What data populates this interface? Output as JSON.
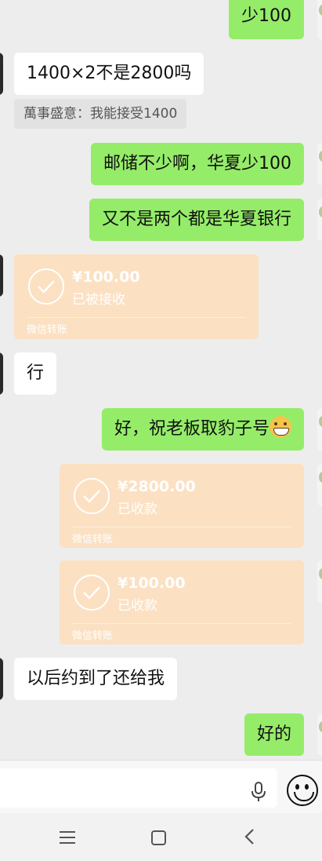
{
  "messages": {
    "partial_top": "少100",
    "m1": "1400×2不是2800吗",
    "quote": "萬事盛意：我能接受1400",
    "m2": "邮储不少啊，华夏少100",
    "m3": "又不是两个都是华夏银行",
    "t1": {
      "amount": "¥100.00",
      "status": "已被接收",
      "footer": "微信转账"
    },
    "m4": "行",
    "m5": "好，祝老板取豹子号",
    "m5_emoji": "grinning-emoji",
    "t2": {
      "amount": "¥2800.00",
      "status": "已收款",
      "footer": "微信转账"
    },
    "t3": {
      "amount": "¥100.00",
      "status": "已收款",
      "footer": "微信转账"
    },
    "m6": "以后约到了还给我",
    "m7": "好的"
  },
  "colors": {
    "sent_bubble": "#95ec69",
    "recv_bubble": "#ffffff",
    "transfer": "#fbe0c2",
    "background": "#ededed"
  },
  "input": {
    "mic_icon": "microphone-icon",
    "emoji_icon": "smiley-icon"
  },
  "nav": {
    "menu_icon": "menu-icon",
    "home_icon": "home-icon",
    "back_icon": "back-icon"
  }
}
